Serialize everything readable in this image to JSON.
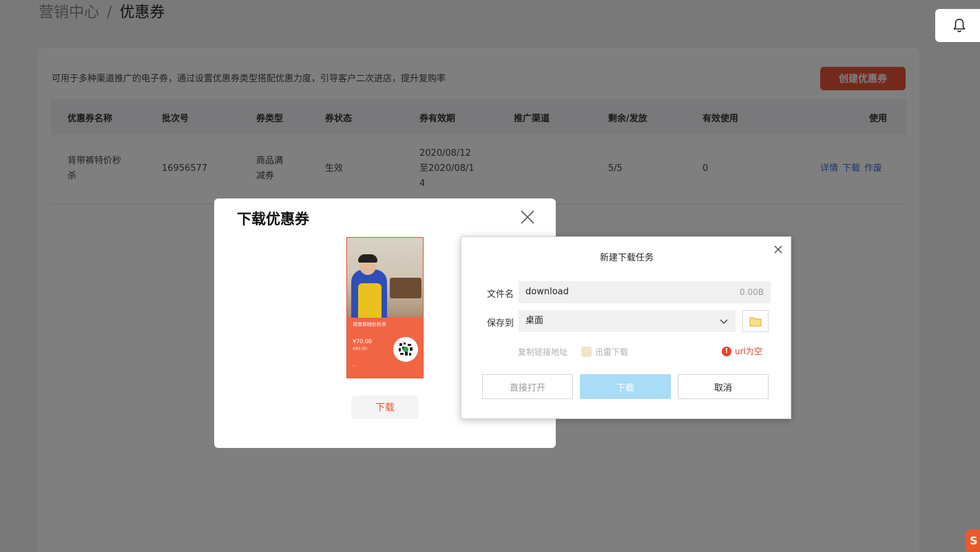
{
  "breadcrumb": {
    "parent": "营销中心",
    "separator": "/",
    "current": "优惠券"
  },
  "card": {
    "description": "可用于多种渠道推广的电子券，通过设置优惠券类型搭配优惠力度，引导客户二次进店，提升复购率",
    "create_button": "创建优惠券"
  },
  "table": {
    "headers": [
      "优惠券名称",
      "批次号",
      "券类型",
      "券状态",
      "券有效期",
      "推广渠道",
      "剩余/发放",
      "有效使用",
      "使用"
    ],
    "rows": [
      {
        "name_line1": "背带裤特价秒",
        "name_line2": "杀",
        "batch": "16956577",
        "type_line1": "商品满",
        "type_line2": "减券",
        "status": "生效",
        "valid_line1": "2020/08/12",
        "valid_line2": "至2020/08/1",
        "valid_line3": "4",
        "channel": "",
        "remain": "5/5",
        "used": "0",
        "ops": {
          "detail": "详情",
          "download": "下载",
          "void": "作废"
        }
      }
    ]
  },
  "coupon_modal": {
    "title": "下载优惠券",
    "poster": {
      "promo": "背带裤特价秒杀",
      "price_now": "¥70.00",
      "price_old": "¥80.00"
    },
    "download_button": "下载"
  },
  "task_dialog": {
    "title": "新建下载任务",
    "filename_label": "文件名",
    "filename_value": "download",
    "filename_size": "0.00B",
    "saveto_label": "保存到",
    "saveto_value": "桌面",
    "copy_link": "复制链接地址",
    "xunlei": "迅雷下载",
    "url_error": "url为空",
    "btn_open": "直接打开",
    "btn_download": "下载",
    "btn_cancel": "取消"
  },
  "colors": {
    "accent": "#e8533a",
    "link": "#3a6fd8",
    "download_disabled": "#a9dcf6"
  }
}
